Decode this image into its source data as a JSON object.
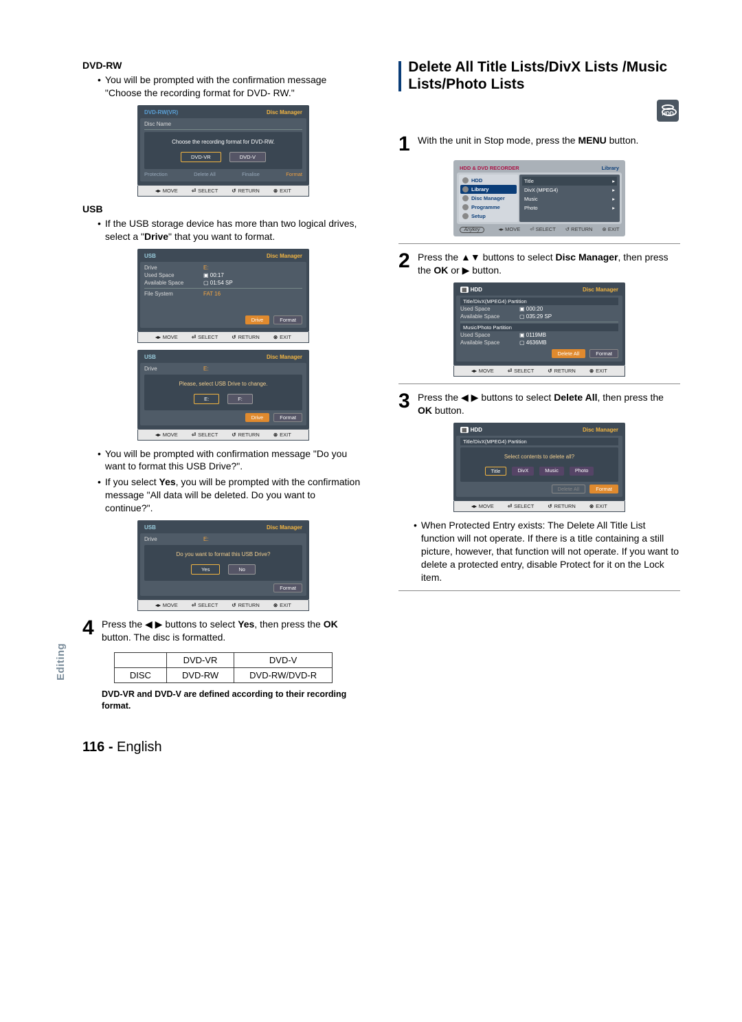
{
  "left": {
    "dvd_rw_head": "DVD-RW",
    "dvd_rw_bullet": "You will be prompted with the confirmation message \"Choose the recording format for DVD- RW.\"",
    "usb_head": "USB",
    "usb_bullet1_pre": "If the USB storage device has more than two logical drives, select a \"",
    "usb_bullet1_bold": "Drive",
    "usb_bullet1_post": "\" that you want to format.",
    "usb_bullet2": "You will be prompted with confirmation message \"Do you want to format this USB Drive?\".",
    "usb_bullet3_pre": "If you select ",
    "usb_bullet3_bold": "Yes",
    "usb_bullet3_post": ", you will be prompted with the confirmation message \"All data will be deleted. Do you want to continue?\".",
    "step4_pre": "Press the ◀ ▶ buttons to select ",
    "step4_b1": "Yes",
    "step4_mid": ", then press the ",
    "step4_b2": "OK",
    "step4_post": " button. The disc is formatted.",
    "table": {
      "h1": "DVD-VR",
      "h2": "DVD-V",
      "r1c0": "DISC",
      "r1c1": "DVD-RW",
      "r1c2": "DVD-RW/DVD-R"
    },
    "footnote": "DVD-VR and DVD-V are defined according to their recording format.",
    "ss1": {
      "device": "DVD-RW(VR)",
      "title": "Disc Manager",
      "disc_name_k": "Disc Name",
      "msg": "Choose the recording format for DVD-RW.",
      "b1": "DVD-VR",
      "b2": "DVD-V",
      "ft_protect": "Protection",
      "ft_del": "Delete All",
      "ft_fin": "Finalise",
      "ft_fmt": "Format"
    },
    "ss2": {
      "device": "USB",
      "title": "Disc Manager",
      "drive_k": "Drive",
      "drive_v": "E:",
      "used_k": "Used Space",
      "used_v": "00:17",
      "avail_k": "Available Space",
      "avail_v": "01:54 SP",
      "fs_k": "File System",
      "fs_v": "FAT 16",
      "btn1": "Drive",
      "btn2": "Format"
    },
    "ss3": {
      "device": "USB",
      "title": "Disc Manager",
      "drive_k": "Drive",
      "drive_v": "E:",
      "msg": "Please, select USB Drive to change.",
      "o1": "E:",
      "o2": "F:",
      "btn1": "Drive",
      "btn2": "Format"
    },
    "ss4": {
      "device": "USB",
      "title": "Disc Manager",
      "drive_k": "Drive",
      "drive_v": "E:",
      "msg": "Do you want to format this USB Drive?",
      "o1": "Yes",
      "o2": "No",
      "btn2": "Format"
    }
  },
  "right": {
    "heading": "Delete All Title Lists/DivX Lists /Music Lists/Photo Lists",
    "hdd_icon_label": "HDD",
    "s1_pre": "With the unit in Stop mode, press the ",
    "s1_bold": "MENU",
    "s1_post": " button.",
    "s2_pre": "Press the ▲▼ buttons to select ",
    "s2_bold": "Disc Manager",
    "s2_mid": ", then press the ",
    "s2_b2": "OK",
    "s2_post": " or ▶ button.",
    "s3_pre": "Press the ◀ ▶ buttons to select ",
    "s3_bold": "Delete All",
    "s3_mid": ", then press the ",
    "s3_b2": "OK",
    "s3_post": " button.",
    "note": "When Protected Entry exists: The Delete All Title List function will not operate. If there is a title containing a still picture, however, that function will not operate. If you want to delete a protected entry, disable Protect for it on the Lock item.",
    "lib": {
      "top_l": "HDD & DVD RECORDER",
      "top_r": "Library",
      "hdd": "HDD",
      "left_items": [
        "Library",
        "Disc Manager",
        "Programme",
        "Setup"
      ],
      "right_items": [
        "Title",
        "DivX (MPEG4)",
        "Music",
        "Photo"
      ],
      "anykey": "Anykey"
    },
    "dm": {
      "device": "HDD",
      "title": "Disc Manager",
      "p1": "Title/DivX(MPEG4) Partition",
      "used_k": "Used Space",
      "used_v": "000:20",
      "avail_k": "Available Space",
      "avail_v": "035:29 SP",
      "p2": "Music/Photo Partition",
      "u2_k": "Used Space",
      "u2_v": "0119MB",
      "a2_k": "Available Space",
      "a2_v": "4636MB",
      "b1": "Delete All",
      "b2": "Format"
    },
    "del": {
      "device": "HDD",
      "title": "Disc Manager",
      "p1": "Title/DivX(MPEG4) Partition",
      "msg": "Select contents to delete all?",
      "opts": [
        "Title",
        "DivX",
        "Music",
        "Photo"
      ],
      "b1": "Delete All",
      "b2": "Format"
    }
  },
  "footer": {
    "move": "MOVE",
    "select": "SELECT",
    "return": "RETURN",
    "exit": "EXIT",
    "sym_move": "◂▸",
    "sym_select": "⏎",
    "sym_return": "↺",
    "sym_exit": "⊗"
  },
  "side_tab": "Editing",
  "page_number": "116 -",
  "page_lang": "English"
}
